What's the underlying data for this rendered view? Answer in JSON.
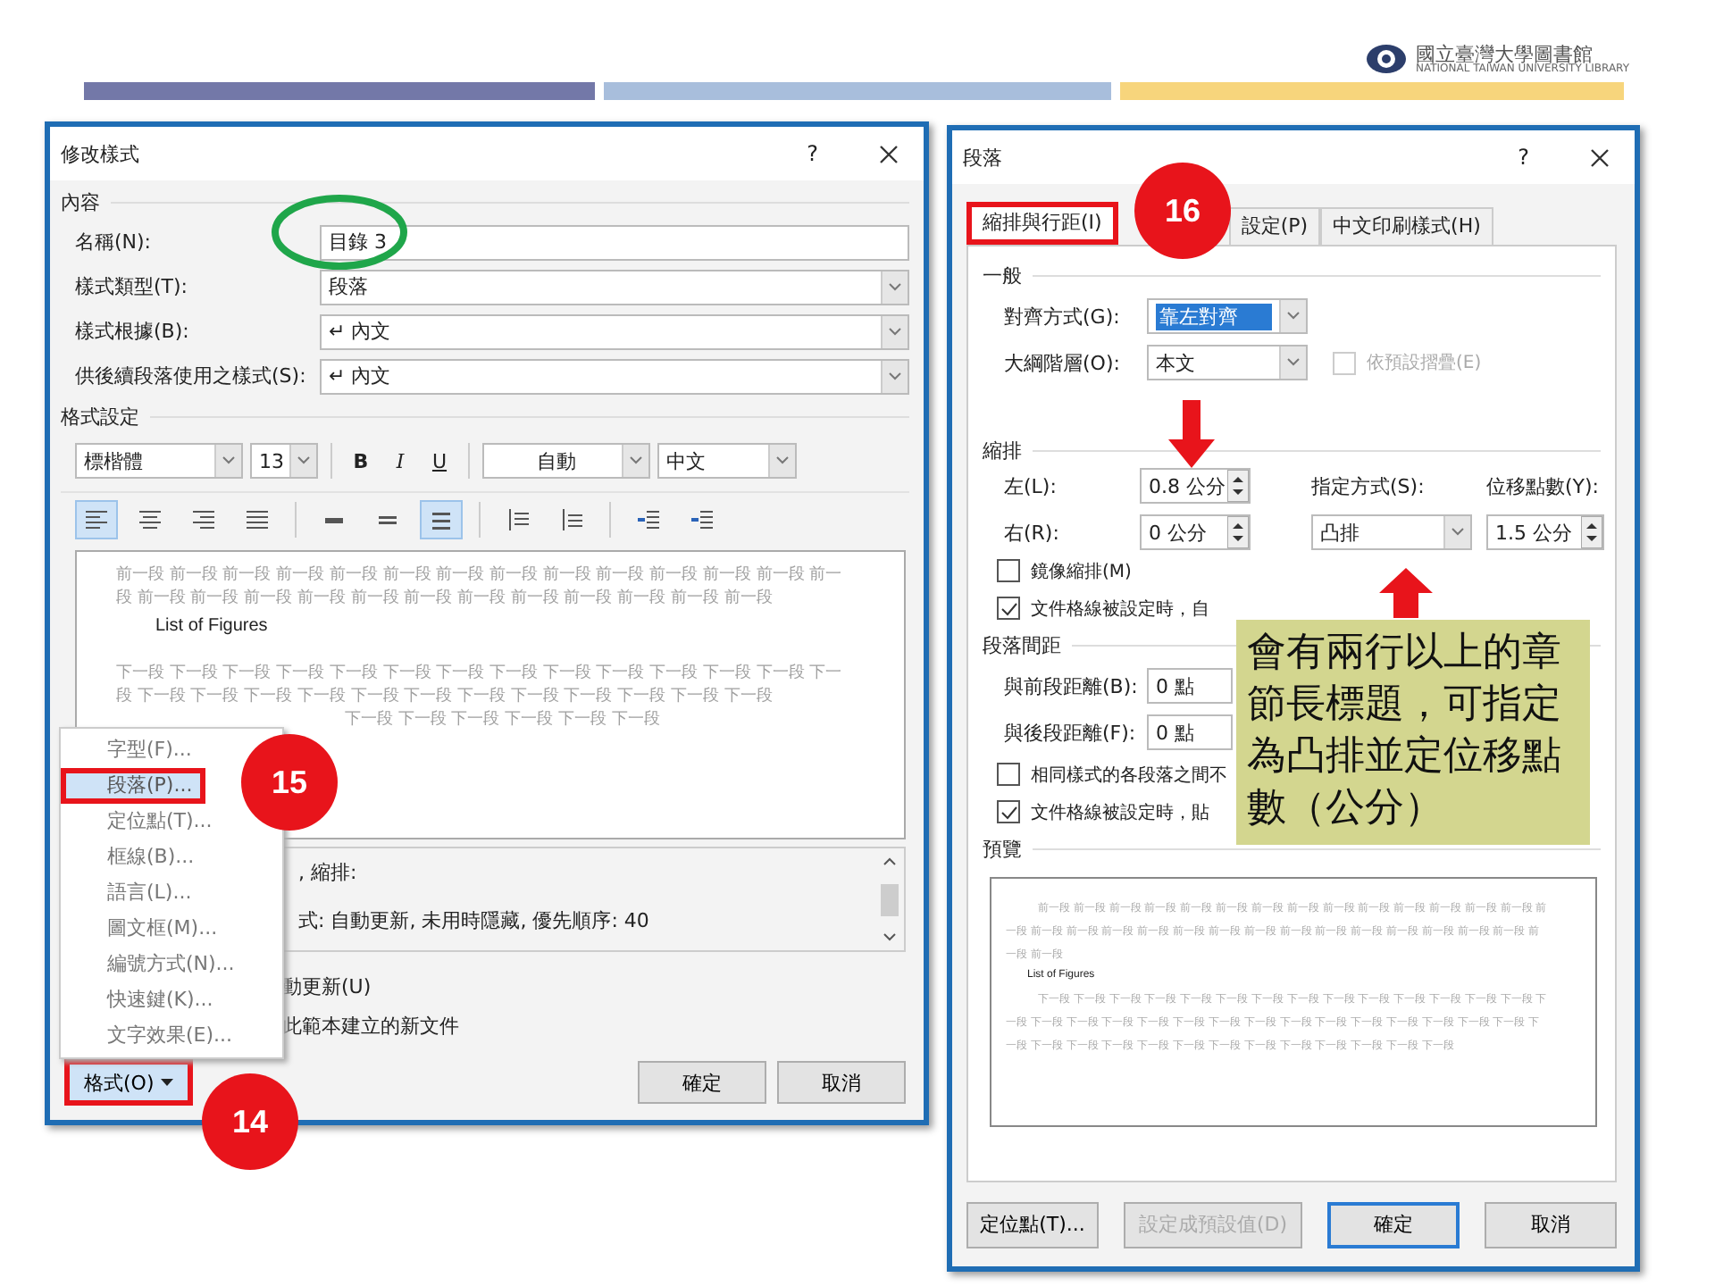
{
  "header": {
    "logo_title": "國立臺灣大學圖書館",
    "logo_subtitle": "NATIONAL TAIWAN UNIVERSITY LIBRARY"
  },
  "modify_style_dialog": {
    "title": "修改樣式",
    "help": "?",
    "content_heading": "內容",
    "fields": [
      {
        "label": "名稱(N):",
        "value": "目錄 3",
        "kind": "text"
      },
      {
        "label": "樣式類型(T):",
        "value": "段落",
        "kind": "dropdown"
      },
      {
        "label": "樣式根據(B):",
        "value": "↵ 內文",
        "kind": "dropdown"
      },
      {
        "label": "供後續段落使用之樣式(S):",
        "value": "↵ 內文",
        "kind": "dropdown"
      }
    ],
    "format_heading": "格式設定",
    "font": "標楷體",
    "size": "13",
    "style_buttons": [
      {
        "label": "B",
        "kind": "bold"
      },
      {
        "label": "I",
        "kind": "italic"
      },
      {
        "label": "U",
        "kind": "underline"
      }
    ],
    "font_color": "自動",
    "language": "中文",
    "paragraph_buttons": [
      {
        "kind": "align-left",
        "selected": true
      },
      {
        "kind": "align-center",
        "selected": false
      },
      {
        "kind": "align-right",
        "selected": false
      },
      {
        "kind": "justify",
        "selected": false
      },
      {
        "kind": "single-spacing",
        "selected": false
      },
      {
        "kind": "one-half-spacing",
        "selected": false
      },
      {
        "kind": "double-spacing",
        "selected": true
      },
      {
        "kind": "space-before",
        "selected": false
      },
      {
        "kind": "space-after",
        "selected": false
      },
      {
        "kind": "decrease-indent",
        "selected": false
      },
      {
        "kind": "increase-indent",
        "selected": false
      }
    ],
    "preview": {
      "previous_lines": [
        "前一段 前一段 前一段 前一段 前一段 前一段 前一段 前一段 前一段 前一段 前一段 前一段 前一段 前一",
        "段 前一段 前一段 前一段 前一段 前一段 前一段 前一段 前一段 前一段 前一段 前一段 前一段"
      ],
      "sample": "List of Figures",
      "next_lines": [
        "下一段 下一段 下一段 下一段 下一段 下一段 下一段 下一段 下一段 下一段 下一段 下一段 下一段 下一",
        "段 下一段 下一段 下一段 下一段 下一段 下一段 下一段 下一段 下一段 下一段 下一段 下一段"
      ],
      "next_text_tail": "下一段 下一段 下一段 下一段 下一段 下一段"
    },
    "description": [
      ", 縮排:",
      "式: 自動更新, 未用時隱藏, 優先順序: 40"
    ],
    "options": [
      "動更新(U)",
      "此範本建立的新文件"
    ],
    "format_button": {
      "label": "格式(O)",
      "highlighted": true
    },
    "buttons": [
      "確定",
      "取消"
    ],
    "format_menu": [
      {
        "label": "字型(F)...",
        "selected": false,
        "highlighted": false
      },
      {
        "label": "段落(P)...",
        "selected": true,
        "highlighted": true
      },
      {
        "label": "定位點(T)...",
        "selected": false,
        "highlighted": false
      },
      {
        "label": "框線(B)...",
        "selected": false,
        "highlighted": false
      },
      {
        "label": "語言(L)...",
        "selected": false,
        "highlighted": false
      },
      {
        "label": "圖文框(M)...",
        "selected": false,
        "highlighted": false
      },
      {
        "label": "編號方式(N)...",
        "selected": false,
        "highlighted": false
      },
      {
        "label": "快速鍵(K)...",
        "selected": false,
        "highlighted": false
      },
      {
        "label": "文字效果(E)...",
        "selected": false,
        "highlighted": false
      }
    ]
  },
  "paragraph_dialog": {
    "title": "段落",
    "help": "?",
    "tabs": [
      {
        "label": "縮排與行距(I)",
        "selected": true,
        "highlighted": true
      },
      {
        "label": "設定(P)",
        "selected": false,
        "highlighted": false
      },
      {
        "label": "中文印刷樣式(H)",
        "selected": false,
        "highlighted": false
      }
    ],
    "general_heading": "一般",
    "alignment": {
      "label": "對齊方式(G):",
      "value": "靠左對齊",
      "text_selected": true
    },
    "outline_level": {
      "label": "大綱階層(O):",
      "value": "本文"
    },
    "collapse": {
      "label": "依預設摺疊(E)",
      "checked": false,
      "disabled": true
    },
    "indent_heading": "縮排",
    "left": {
      "label": "左(L):",
      "value": "0.8 公分"
    },
    "right": {
      "label": "右(R):",
      "value": "0 公分"
    },
    "special": {
      "label": "指定方式(S):",
      "value": "凸排"
    },
    "by": {
      "label": "位移點數(Y):",
      "value": "1.5 公分"
    },
    "indent_checks": [
      {
        "label": "鏡像縮排(M)",
        "checked": false
      },
      {
        "label": "文件格線被設定時，自",
        "checked": true
      }
    ],
    "spacing_heading": "段落間距",
    "before": {
      "label": "與前段距離(B):",
      "value": "0 點"
    },
    "after": {
      "label": "與後段距離(F):",
      "value": "0 點"
    },
    "spacing_checks": [
      {
        "label": "相同樣式的各段落之間不",
        "checked": false
      },
      {
        "label": "文件格線被設定時，貼",
        "checked": true
      }
    ],
    "preview_heading": "預覽",
    "preview": {
      "previous_lines": [
        "前一段 前一段 前一段 前一段 前一段 前一段 前一段 前一段 前一段 前一段 前一段 前一段 前一段 前一段 前",
        "一段 前一段 前一段 前一段 前一段 前一段 前一段 前一段 前一段 前一段 前一段 前一段 前一段 前一段 前一段 前",
        "一段 前一段"
      ],
      "sample": "List of Figures",
      "next_lines": [
        "下一段 下一段 下一段 下一段 下一段 下一段 下一段 下一段 下一段 下一段 下一段 下一段 下一段 下一段 下",
        "一段 下一段 下一段 下一段 下一段 下一段 下一段 下一段 下一段 下一段 下一段 下一段 下一段 下一段 下一段 下",
        "一段 下一段 下一段 下一段 下一段 下一段 下一段 下一段 下一段 下一段 下一段 下一段 下一段"
      ]
    },
    "buttons": [
      {
        "label": "定位點(T)...",
        "kind": "normal"
      },
      {
        "label": "設定成預設值(D)",
        "kind": "disabled"
      },
      {
        "label": "確定",
        "kind": "default"
      },
      {
        "label": "取消",
        "kind": "normal"
      }
    ]
  },
  "annotations": {
    "badges": [
      "15",
      "14",
      "16"
    ],
    "note": "會有兩行以上的章節長標題，可指定為凸排並定位移點數（公分）"
  }
}
